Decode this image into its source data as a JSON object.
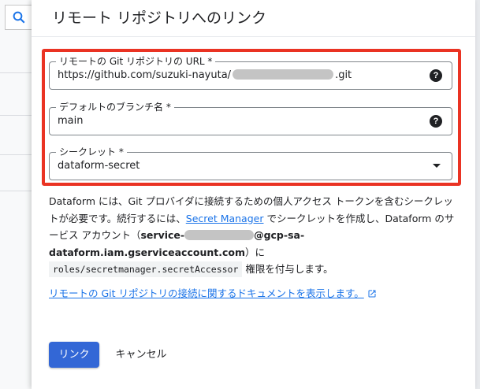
{
  "dialog": {
    "title": "リモート リポジトリへのリンク"
  },
  "fields": {
    "url": {
      "label": "リモートの Git リポジトリの URL *",
      "value_prefix": "https://github.com/suzuki-nayuta/",
      "value_suffix": ".git",
      "help": "?"
    },
    "branch": {
      "label": "デフォルトのブランチ名 *",
      "value": "main",
      "help": "?"
    },
    "secret": {
      "label": "シークレット *",
      "value": "dataform-secret"
    }
  },
  "description": {
    "part1": "Dataform には、Git プロバイダに接続するための個人アクセス トークンを含むシークレットが必要です。続行するには、",
    "link": "Secret Manager",
    "part2": " でシークレットを作成し、Dataform のサービス アカウント（",
    "account_prefix": "service-",
    "account_suffix": "@gcp-sa-dataform.iam.gserviceaccount.com",
    "part3": "）に ",
    "role": "roles/secretmanager.secretAccessor",
    "part4": " 権限を付与します。"
  },
  "doc_link": {
    "label": "リモートの Git リポジトリの接続に関するドキュメントを表示します。"
  },
  "buttons": {
    "link": "リンク",
    "cancel": "キャンセル"
  },
  "icons": {
    "search": "search-icon",
    "help": "help-circle-icon",
    "dropdown": "dropdown-caret-icon",
    "external": "open-in-new-icon"
  },
  "colors": {
    "highlight": "#ea3323",
    "primary": "#3367d6",
    "link": "#1a73e8"
  }
}
